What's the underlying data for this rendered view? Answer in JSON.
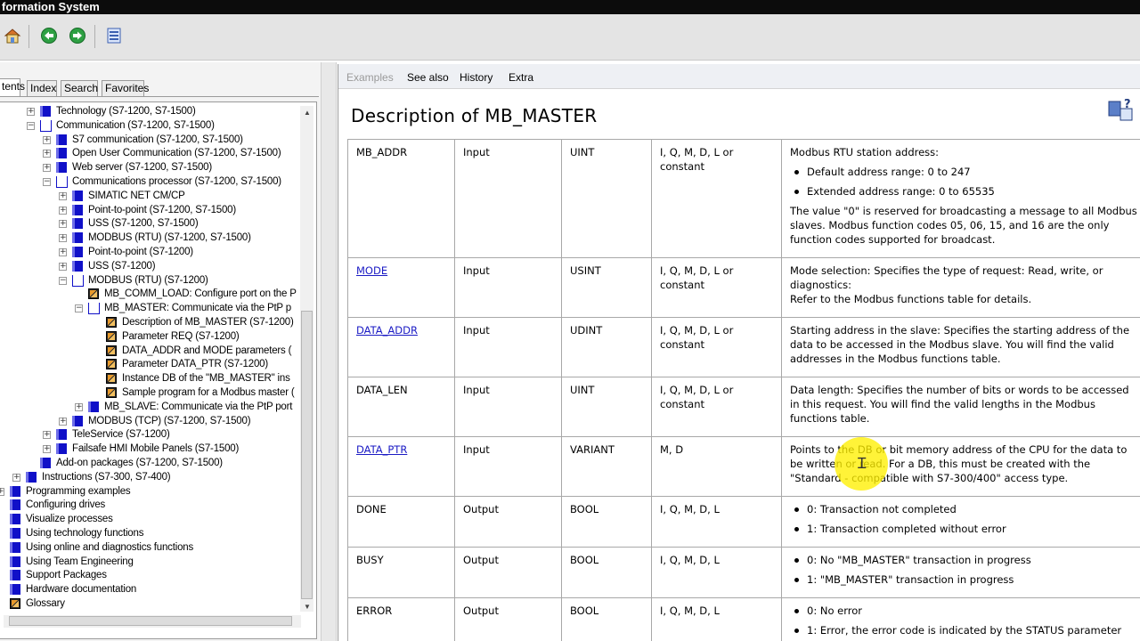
{
  "window": {
    "title": "formation System"
  },
  "toolbar": {
    "home_icon": "home-icon",
    "back_icon": "back-arrow-icon",
    "forward_icon": "forward-arrow-icon",
    "print_icon": "print-icon"
  },
  "left_tabs": [
    "tents",
    "Index",
    "Search",
    "Favorites"
  ],
  "tree": [
    {
      "label": "Technology (S7-1200, S7-1500)",
      "level": 2,
      "icon": "book",
      "exp": "+"
    },
    {
      "label": "Communication (S7-1200, S7-1500)",
      "level": 2,
      "icon": "open",
      "exp": "-"
    },
    {
      "label": "S7 communication (S7-1200, S7-1500)",
      "level": 3,
      "icon": "book",
      "exp": "+"
    },
    {
      "label": "Open User Communication (S7-1200, S7-1500)",
      "level": 3,
      "icon": "book",
      "exp": "+"
    },
    {
      "label": "Web server (S7-1200, S7-1500)",
      "level": 3,
      "icon": "book",
      "exp": "+"
    },
    {
      "label": "Communications processor (S7-1200, S7-1500)",
      "level": 3,
      "icon": "open",
      "exp": "-"
    },
    {
      "label": "SIMATIC NET CM/CP",
      "level": 4,
      "icon": "book",
      "exp": "+"
    },
    {
      "label": "Point-to-point (S7-1200, S7-1500)",
      "level": 4,
      "icon": "book",
      "exp": "+"
    },
    {
      "label": "USS (S7-1200, S7-1500)",
      "level": 4,
      "icon": "book",
      "exp": "+"
    },
    {
      "label": "MODBUS (RTU) (S7-1200, S7-1500)",
      "level": 4,
      "icon": "book",
      "exp": "+"
    },
    {
      "label": "Point-to-point (S7-1200)",
      "level": 4,
      "icon": "book",
      "exp": "+"
    },
    {
      "label": "USS (S7-1200)",
      "level": 4,
      "icon": "book",
      "exp": "+"
    },
    {
      "label": "MODBUS (RTU) (S7-1200)",
      "level": 4,
      "icon": "open",
      "exp": "-"
    },
    {
      "label": "MB_COMM_LOAD: Configure port on the P",
      "level": 5,
      "icon": "page",
      "exp": ""
    },
    {
      "label": "MB_MASTER: Communicate via the PtP p",
      "level": 5,
      "icon": "open",
      "exp": "-"
    },
    {
      "label": "Description of MB_MASTER (S7-1200)",
      "level": 6,
      "icon": "page",
      "exp": ""
    },
    {
      "label": "Parameter REQ (S7-1200)",
      "level": 6,
      "icon": "page",
      "exp": ""
    },
    {
      "label": "DATA_ADDR and MODE parameters (",
      "level": 6,
      "icon": "page",
      "exp": ""
    },
    {
      "label": "Parameter DATA_PTR (S7-1200)",
      "level": 6,
      "icon": "page",
      "exp": ""
    },
    {
      "label": "Instance DB of the \"MB_MASTER\" ins",
      "level": 6,
      "icon": "page",
      "exp": ""
    },
    {
      "label": "Sample program for a Modbus master (",
      "level": 6,
      "icon": "page",
      "exp": ""
    },
    {
      "label": "MB_SLAVE: Communicate via the PtP port",
      "level": 5,
      "icon": "book",
      "exp": "+"
    },
    {
      "label": "MODBUS (TCP) (S7-1200, S7-1500)",
      "level": 4,
      "icon": "book",
      "exp": "+"
    },
    {
      "label": "TeleService (S7-1200)",
      "level": 3,
      "icon": "book",
      "exp": "+"
    },
    {
      "label": "Failsafe HMI Mobile Panels (S7-1500)",
      "level": 3,
      "icon": "book",
      "exp": "+"
    },
    {
      "label": "Add-on packages (S7-1200, S7-1500)",
      "level": 2,
      "icon": "book",
      "exp": ""
    },
    {
      "label": "Instructions (S7-300, S7-400)",
      "level": 1,
      "icon": "book",
      "exp": "+"
    },
    {
      "label": "Programming examples",
      "level": 0,
      "icon": "book",
      "exp": "+"
    },
    {
      "label": "Configuring drives",
      "level": 0,
      "icon": "book",
      "exp": ""
    },
    {
      "label": "Visualize processes",
      "level": 0,
      "icon": "book",
      "exp": ""
    },
    {
      "label": "Using technology functions",
      "level": 0,
      "icon": "book",
      "exp": ""
    },
    {
      "label": "Using online and diagnostics functions",
      "level": 0,
      "icon": "book",
      "exp": ""
    },
    {
      "label": "Using Team Engineering",
      "level": 0,
      "icon": "book",
      "exp": ""
    },
    {
      "label": "Support Packages",
      "level": 0,
      "icon": "book",
      "exp": ""
    },
    {
      "label": "Hardware documentation",
      "level": 0,
      "icon": "book",
      "exp": ""
    },
    {
      "label": "Glossary",
      "level": 0,
      "icon": "page",
      "exp": ""
    }
  ],
  "selected_tree_item": "Description of MB_MASTER (S7-1200)",
  "right_tabs": {
    "examples": "Examples",
    "see_also": "See also",
    "history": "History",
    "extra": "Extra"
  },
  "document": {
    "title": "Description of MB_MASTER",
    "rows": [
      {
        "name": "MB_ADDR",
        "link": false,
        "decl": "Input",
        "type": "UINT",
        "area": "I, Q, M, D, L or constant",
        "desc": {
          "text": "Modbus RTU station address:",
          "bullets": [
            "Default address range: 0 to 247",
            "Extended address range: 0 to 65535"
          ],
          "after": "The value \"0\" is reserved for broadcasting a message to all Modbus slaves. Modbus function codes 05, 06, 15, and 16 are the only function codes supported for broadcast."
        }
      },
      {
        "name": "MODE",
        "link": true,
        "decl": "Input",
        "type": "USINT",
        "area": "I, Q, M, D, L or constant",
        "desc": {
          "text": "Mode selection: Specifies the type of request: Read, write, or diagnostics:",
          "bullets": [],
          "after": "Refer to the Modbus functions table for details."
        }
      },
      {
        "name": "DATA_ADDR",
        "link": true,
        "decl": "Input",
        "type": "UDINT",
        "area": "I, Q, M, D, L or constant",
        "desc": {
          "text": "Starting address in the slave: Specifies the starting address of the data to be accessed in the Modbus slave. You will find the valid addresses in the Modbus functions table.",
          "bullets": [],
          "after": ""
        }
      },
      {
        "name": "DATA_LEN",
        "link": false,
        "decl": "Input",
        "type": "UINT",
        "area": "I, Q, M, D, L or constant",
        "desc": {
          "text": "Data length: Specifies the number of bits or words to be accessed in this request. You will find the valid lengths in the Modbus functions table.",
          "bullets": [],
          "after": ""
        }
      },
      {
        "name": "DATA_PTR",
        "link": true,
        "decl": "Input",
        "type": "VARIANT",
        "area": "M, D",
        "desc": {
          "text": "Points to the DB or bit memory address of the CPU for the data to be written or read. For a DB, this must be created with the \"Standard - compatible with S7-300/400\" access type.",
          "bullets": [],
          "after": ""
        }
      },
      {
        "name": "DONE",
        "link": false,
        "decl": "Output",
        "type": "BOOL",
        "area": "I, Q, M, D, L",
        "desc": {
          "text": "",
          "bullets": [
            "0: Transaction not completed",
            "1: Transaction completed without error"
          ],
          "after": ""
        }
      },
      {
        "name": "BUSY",
        "link": false,
        "decl": "Output",
        "type": "BOOL",
        "area": "I, Q, M, D, L",
        "desc": {
          "text": "",
          "bullets": [
            "0: No \"MB_MASTER\" transaction in progress",
            "1: \"MB_MASTER\" transaction in progress"
          ],
          "after": ""
        }
      },
      {
        "name": "ERROR",
        "link": false,
        "decl": "Output",
        "type": "BOOL",
        "area": "I, Q, M, D, L",
        "desc": {
          "text": "",
          "bullets": [
            "0: No error",
            "1: Error, the error code is indicated by the STATUS parameter"
          ],
          "after": ""
        }
      }
    ]
  },
  "colors": {
    "link": "#1b1bc4",
    "book_icon": "#1010c8",
    "cursor_highlight": "#fff000"
  }
}
